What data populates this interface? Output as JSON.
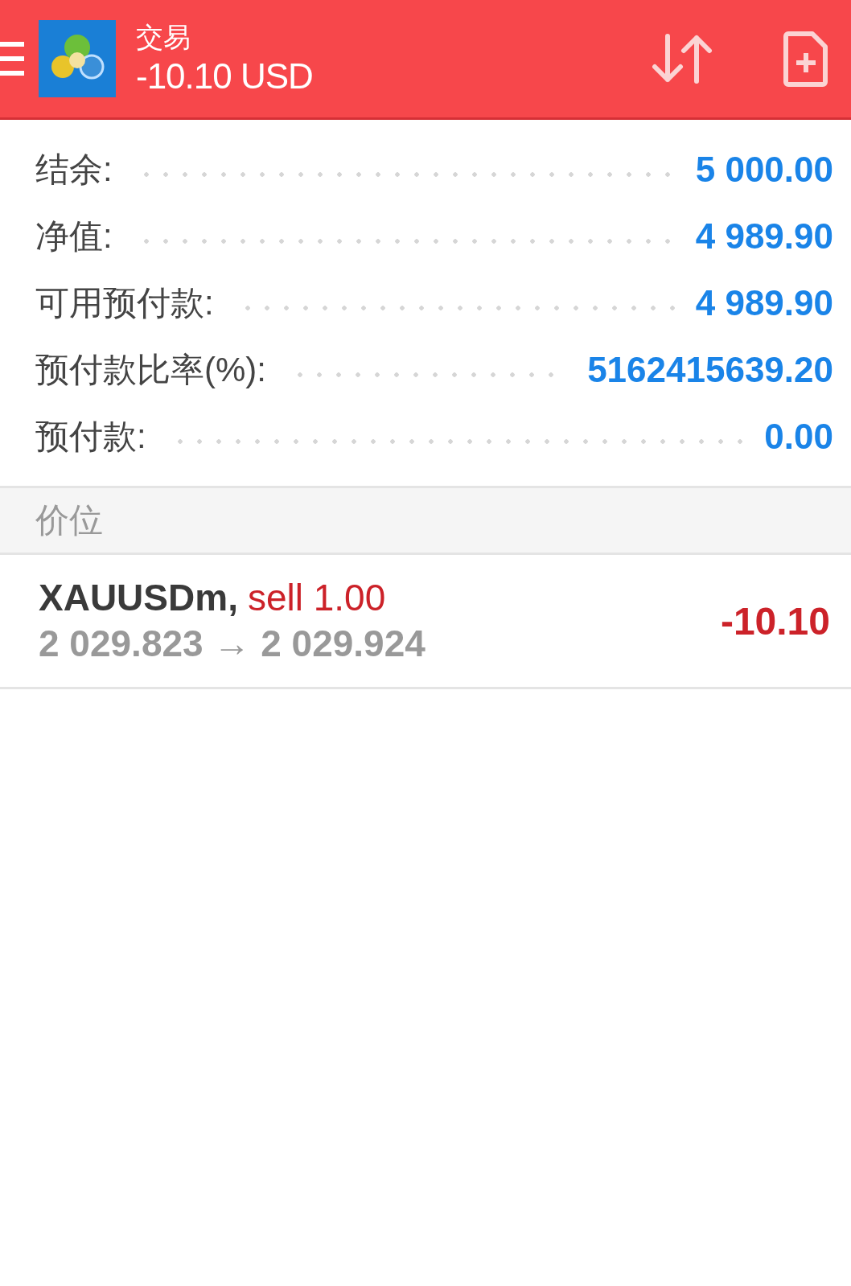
{
  "header": {
    "title": "交易",
    "subtitle": "-10.10 USD"
  },
  "summary": [
    {
      "label": "结余:",
      "value": "5 000.00"
    },
    {
      "label": "净值:",
      "value": "4 989.90"
    },
    {
      "label": "可用预付款:",
      "value": "4 989.90"
    },
    {
      "label": "预付款比率(%):",
      "value": "5162415639.20"
    },
    {
      "label": "预付款:",
      "value": "0.00"
    }
  ],
  "section": {
    "title": "价位"
  },
  "positions": [
    {
      "symbol": "XAUUSDm,",
      "order": "sell 1.00",
      "prices": "2 029.823 → 2 029.924",
      "profit": "-10.10"
    }
  ]
}
